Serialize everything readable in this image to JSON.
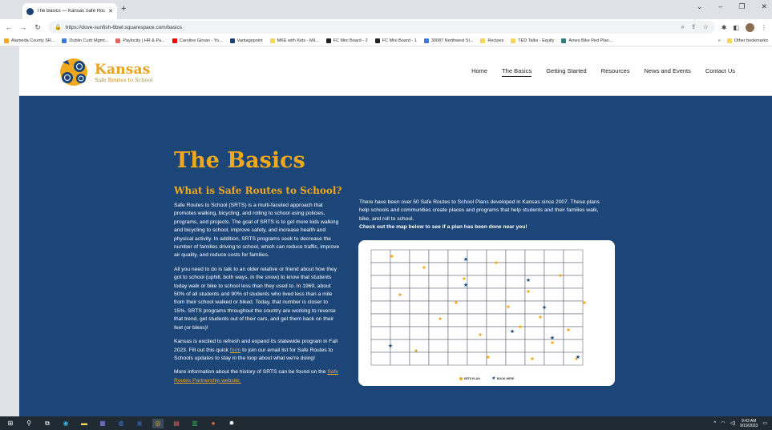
{
  "browser": {
    "tab_title": "The Basics — Kansas Safe Routes",
    "url": "https://dove-sunfish-6bwl.squarespace.com/basics",
    "bookmarks": [
      {
        "label": "Alameda County SR...",
        "color": "#f1a81e"
      },
      {
        "label": "Dublin Curb Mgmt...",
        "color": "#3c78d8"
      },
      {
        "label": "Paylocity | HR & Pa...",
        "color": "#e06666"
      },
      {
        "label": "Caroline Girvan - Yo...",
        "color": "#ff0000"
      },
      {
        "label": "Vantagepoint",
        "color": "#1a4275"
      },
      {
        "label": "MKE with Kids - Mil...",
        "color": "#f6d55c"
      },
      {
        "label": "FC Mini Board - 2",
        "color": "#222222"
      },
      {
        "label": "FC Mini Board - 1",
        "color": "#222222"
      },
      {
        "label": "30087 Northwest Si...",
        "color": "#3c78d8"
      },
      {
        "label": "Recipes",
        "color": "#f6d55c"
      },
      {
        "label": "TED Talks - Equity",
        "color": "#f6d55c"
      },
      {
        "label": "Ames Bike Ped Plan...",
        "color": "#2e7d7d"
      }
    ],
    "other_bookmarks": "Other bookmarks"
  },
  "site": {
    "brand": "Kansas",
    "tagline": "Safe Routes to School",
    "nav": [
      "Home",
      "The Basics",
      "Getting Started",
      "Resources",
      "News and Events",
      "Contact Us"
    ],
    "active_nav": "The Basics"
  },
  "content": {
    "title": "The Basics",
    "subtitle": "What is Safe Routes to School?",
    "p1": "Safe Routes to School (SRTS) is a multi-faceted approach that promotes walking, bicycling, and rolling to school using policies, programs, and projects. The goal of SRTS is to get more kids walking and bicycling to school, improve safety, and increase health and physical activity. In addition, SRTS programs seek to decrease the number of families driving to school, which can reduce traffic, improve air quality, and reduce costs for families.",
    "p2": "All you need to do is talk to an older relative or friend about how they got to school (uphill, both ways, in the snow) to know that students today walk or bike to school less than they used to. In 1969, about 50% of all students and 90% of students who lived less than a mile from their school walked or biked. Today, that number is closer to 15%. SRTS programs throughout the country are working to reverse that trend, get students out of their cars, and get them back on their feet (or bikes)!",
    "p3_before": "Kansas is excited to refresh and expand its statewide program in Fall 2023. Fill out this quick",
    "p3_link": "form",
    "p3_after": "to join our email list for Safe Routes to Schools updates to stay in the loop about what we're doing!",
    "p4_before": "More information about the history of SRTS can be found on the",
    "p4_link": "Safe Routes Partnership website.",
    "right_text": "There have been over 50 Safe Routes to School Plans developed in Kansas since 2007. These plans help schools and communities create places and programs that help students and their families walk, bike, and roll to school.",
    "right_cta": "Check out the map below to see if a plan has been done near you!"
  },
  "map": {
    "legend_dot": "SRTS PLAN",
    "legend_star": "BOOK HERE"
  },
  "taskbar": {
    "time": "9:43 AM",
    "date": "9/19/2023"
  }
}
